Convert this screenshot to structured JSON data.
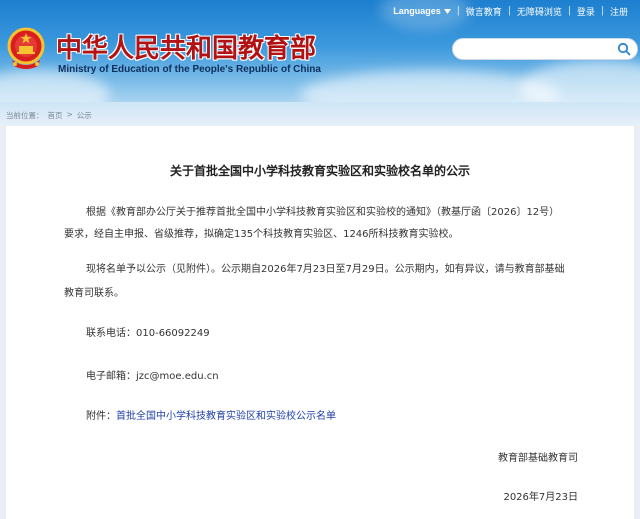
{
  "topbar": {
    "languages": "Languages",
    "items": [
      "微言教育",
      "无障碍浏览",
      "登录",
      "注册"
    ]
  },
  "header": {
    "title_cn": "中华人民共和国教育部",
    "title_en": "Ministry of Education of the People's Republic of China",
    "search_placeholder": ""
  },
  "breadcrumb": {
    "label": "当前位置：",
    "items": [
      "首页",
      "公示"
    ],
    "separator": ">"
  },
  "article": {
    "title": "关于首批全国中小学科技教育实验区和实验校名单的公示",
    "para1_line1": "根据《教育部办公厅关于推荐首批全国中小学科技教育实验区和实验校的通知》（教基厅函〔2026〕12号）",
    "para1_line2": "要求，经自主申报、省级推荐，拟确定135个科技教育实验区、1246所科技教育实验校。",
    "para2_line1": "现将名单予以公示（见附件）。公示期自2026年7月23日至7月29日。公示期内，如有异议，请与教育部基础",
    "para2_line2": "教育司联系。",
    "phone_label": "联系电话：",
    "phone": "010-66092249",
    "email_label": "电子邮箱：",
    "email": "jzc@moe.edu.cn",
    "attachment_label": "附件：",
    "attachment_link": "首批全国中小学科技教育实验区和实验校公示名单",
    "signature": "教育部基础教育司",
    "date": "2026年7月23日"
  },
  "colors": {
    "brand_red": "#b21213",
    "link_blue": "#1f3fa8",
    "header_blue": "#1d7fcf"
  }
}
